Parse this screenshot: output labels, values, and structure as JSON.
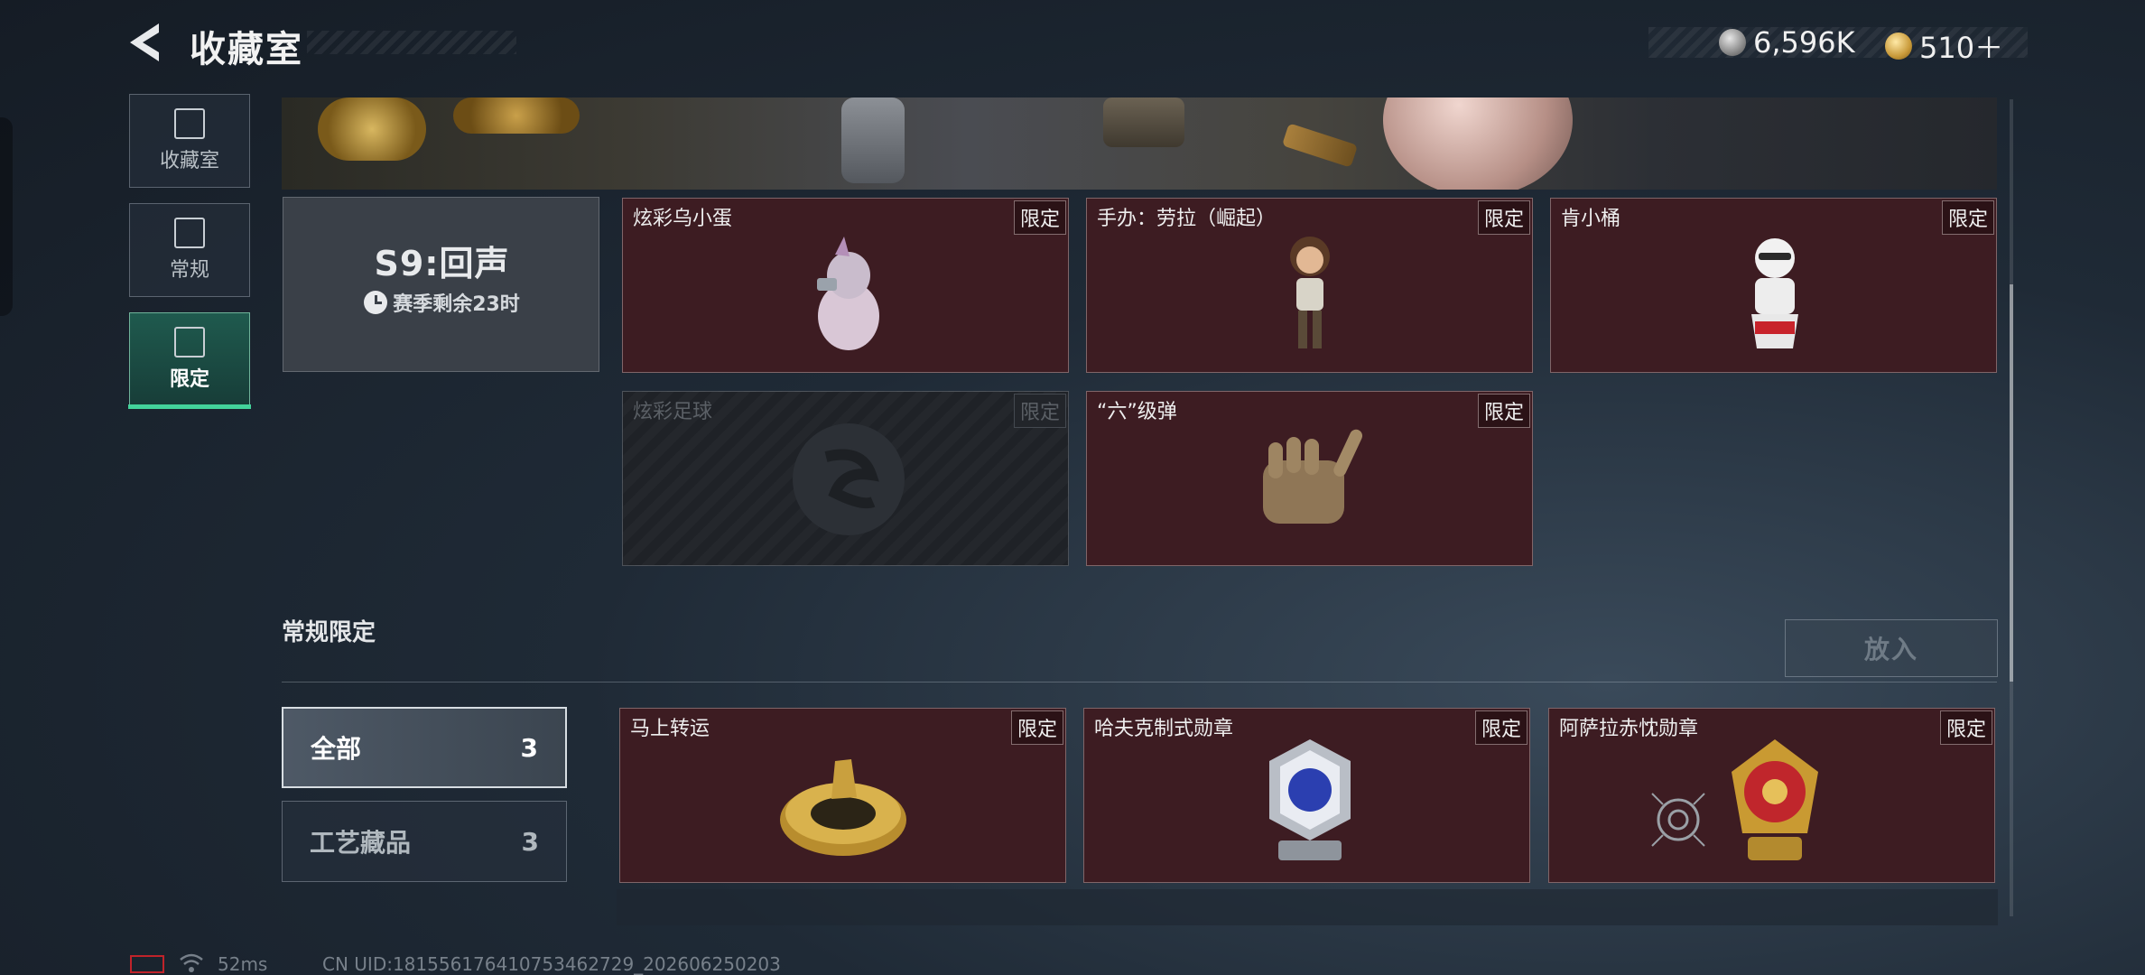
{
  "header": {
    "title": "收藏室",
    "currency": [
      {
        "icon": "silver-coin-icon",
        "value": "6,596K"
      },
      {
        "icon": "gold-coin-icon",
        "value": "510＋"
      }
    ]
  },
  "sidebar": {
    "items": [
      {
        "label": "收藏室",
        "icon": "collection-room-icon",
        "active": false
      },
      {
        "label": "常规",
        "icon": "regular-icon",
        "active": false
      },
      {
        "label": "限定",
        "icon": "limited-icon",
        "active": true
      }
    ]
  },
  "season": {
    "title": "S9:回声",
    "remaining": "赛季剩余23时"
  },
  "season_items": [
    {
      "name": "炫彩乌小蛋",
      "tag": "限定",
      "locked": false
    },
    {
      "name": "手办：劳拉（崛起）",
      "tag": "限定",
      "locked": false
    },
    {
      "name": "肯小桶",
      "tag": "限定",
      "locked": false
    },
    {
      "name": "炫彩足球",
      "tag": "限定",
      "locked": true
    },
    {
      "name": "“六”级弹",
      "tag": "限定",
      "locked": false
    }
  ],
  "regular_limited": {
    "title": "常规限定",
    "put_button": "放入",
    "filters": [
      {
        "label": "全部",
        "count": "3",
        "active": true
      },
      {
        "label": "工艺藏品",
        "count": "3",
        "active": false
      }
    ],
    "items": [
      {
        "name": "马上转运",
        "tag": "限定"
      },
      {
        "name": "哈夫克制式勋章",
        "tag": "限定"
      },
      {
        "name": "阿萨拉赤忱勋章",
        "tag": "限定"
      }
    ]
  },
  "footer": {
    "ping": "52ms",
    "uid": "CN UID:181556176410753462729_202606250203"
  }
}
